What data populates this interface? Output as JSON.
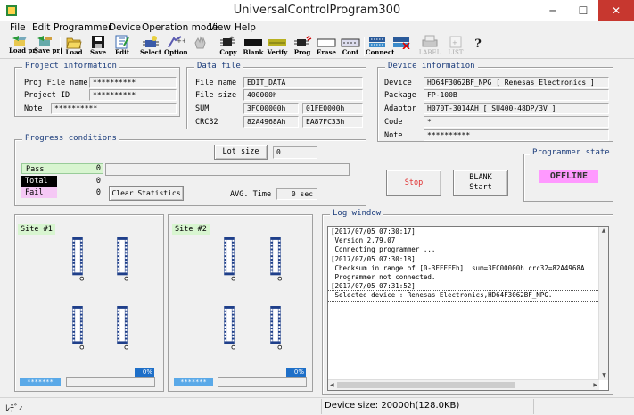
{
  "window": {
    "title": "UniversalControlProgram300",
    "minimize": "─",
    "maximize": "☐",
    "close": "✕"
  },
  "menu": [
    "File",
    "Edit",
    "Programmer",
    "Device",
    "Operation mode",
    "View",
    "Help"
  ],
  "toolbar": {
    "load_prj": "Load prj",
    "save_prj": "Save prj",
    "load": "Load",
    "save": "Save",
    "edit": "Edit",
    "select": "Select",
    "option": "Option",
    "copy": "Copy",
    "blank": "Blank",
    "verify": "Verify",
    "prog": "Prog",
    "erase": "Erase",
    "cont": "Cont",
    "connect": "Connect",
    "disconnect": "",
    "label": "LABEL",
    "list": "LIST",
    "help": "?"
  },
  "project": {
    "title": "Project information",
    "file_name_label": "Proj File name",
    "file_name": "**********",
    "id_label": "Project ID",
    "id": "**********",
    "note_label": "Note",
    "note": "**********"
  },
  "datafile": {
    "title": "Data file",
    "name_label": "File name",
    "name": "EDIT_DATA",
    "size_label": "File size",
    "size": "400000h",
    "sum_label": "SUM",
    "sum1": "3FC00000h",
    "sum2": "01FE0000h",
    "crc_label": "CRC32",
    "crc1": "82A4968Ah",
    "crc2": "EA87FC33h"
  },
  "device": {
    "title": "Device information",
    "device_label": "Device",
    "device": "HD64F3062BF_NPG [ Renesas Electronics ]",
    "package_label": "Package",
    "package": "FP-100B",
    "adaptor_label": "Adaptor",
    "adaptor": "H070T-3014AH [ SU400-48DP/3V ]",
    "code_label": "Code",
    "code": "*",
    "note_label": "Note",
    "note": "**********"
  },
  "progress": {
    "title": "Progress conditions",
    "lot_size_button": "Lot size",
    "lot_size": "0",
    "pass_label": "Pass",
    "pass": "0",
    "total_label": "Total",
    "total": "0",
    "fail_label": "Fail",
    "fail": "0",
    "clear_button": "Clear Statistics",
    "avg_label": "AVG. Time",
    "avg": "0 sec"
  },
  "actions": {
    "stop": "Stop",
    "blank_start": "BLANK\nStart"
  },
  "programmer_state": {
    "title": "Programmer state",
    "state": "OFFLINE"
  },
  "sites": [
    {
      "label": "Site #1",
      "id": "*******",
      "percent": "0%"
    },
    {
      "label": "Site #2",
      "id": "*******",
      "percent": "0%"
    }
  ],
  "log": {
    "title": "Log window",
    "lines": [
      "[2017/07/05 07:30:17]",
      " Version 2.79.07",
      " Connecting programmer ...",
      "[2017/07/05 07:30:18]",
      " Checksum in range of [0-3FFFFFh]  sum=3FC00000h crc32=82A4968A",
      " Programmer not connected.",
      "[2017/07/05 07:31:52]",
      " Selected device : Renesas Electronics,HD64F3062BF_NPG."
    ]
  },
  "status": {
    "left": "ﾚﾃﾞｨ",
    "device_size": "Device size: 20000h(128.0KB)"
  },
  "colors": {
    "pass": "#d8f5d0",
    "total": "#000000",
    "fail": "#f5c8f5",
    "offline": "#ff99ff",
    "stop": "#e03030",
    "accent": "#1e6fc8"
  }
}
